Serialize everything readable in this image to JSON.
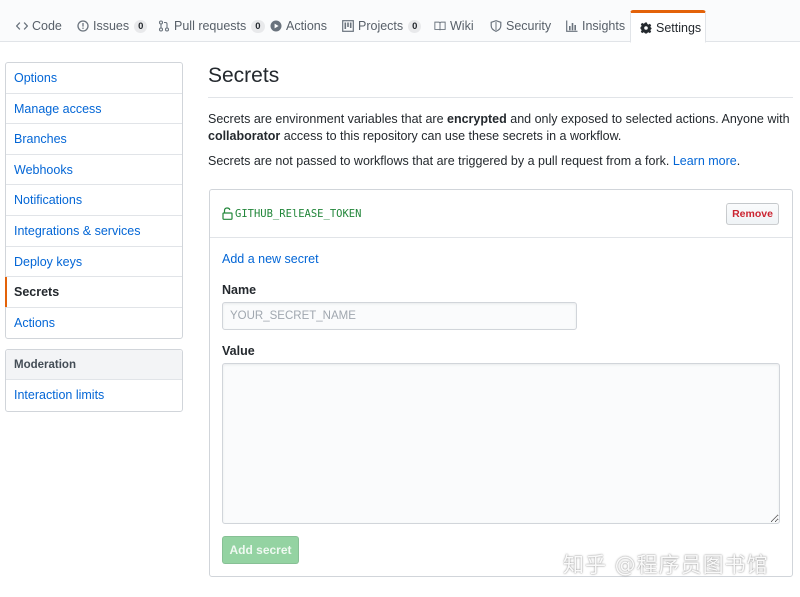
{
  "tabs": [
    {
      "label": "Code",
      "icon": "code-icon",
      "count": null
    },
    {
      "label": "Issues",
      "icon": "issue-icon",
      "count": "0"
    },
    {
      "label": "Pull requests",
      "icon": "pull-request-icon",
      "count": "0"
    },
    {
      "label": "Actions",
      "icon": "play-icon",
      "count": null
    },
    {
      "label": "Projects",
      "icon": "project-icon",
      "count": "0"
    },
    {
      "label": "Wiki",
      "icon": "book-icon",
      "count": null
    },
    {
      "label": "Security",
      "icon": "shield-icon",
      "count": null
    },
    {
      "label": "Insights",
      "icon": "graph-icon",
      "count": null
    },
    {
      "label": "Settings",
      "icon": "gear-icon",
      "count": null,
      "selected": true
    }
  ],
  "sidebar": {
    "items": [
      {
        "label": "Options"
      },
      {
        "label": "Manage access"
      },
      {
        "label": "Branches"
      },
      {
        "label": "Webhooks"
      },
      {
        "label": "Notifications"
      },
      {
        "label": "Integrations & services"
      },
      {
        "label": "Deploy keys"
      },
      {
        "label": "Secrets",
        "selected": true
      },
      {
        "label": "Actions"
      }
    ],
    "moderation": {
      "heading": "Moderation",
      "items": [
        {
          "label": "Interaction limits"
        }
      ]
    }
  },
  "main": {
    "title": "Secrets",
    "intro": {
      "p1_a": "Secrets are environment variables that are ",
      "p1_b": "encrypted",
      "p1_c": " and only exposed to selected actions. Anyone with ",
      "p1_d": "collaborator",
      "p1_e": " access to this repository can use these secrets in a workflow.",
      "p2_a": "Secrets are not passed to workflows that are triggered by a pull request from a fork. ",
      "p2_link": "Learn more",
      "p2_b": "."
    },
    "secret": {
      "name": "GITHUB_RElEASE_TOKEN",
      "icon": "unlock-icon",
      "remove_label": "Remove"
    },
    "form": {
      "add_link": "Add a new secret",
      "name_label": "Name",
      "name_placeholder": "YOUR_SECRET_NAME",
      "value_label": "Value",
      "submit_label": "Add secret"
    }
  },
  "watermark": "知乎 @程序员图书馆",
  "colors": {
    "accent": "#e36209",
    "link": "#0366d6",
    "secret_name": "#22863a",
    "danger": "#cb2431",
    "disabled_green": "#94d3a2"
  }
}
